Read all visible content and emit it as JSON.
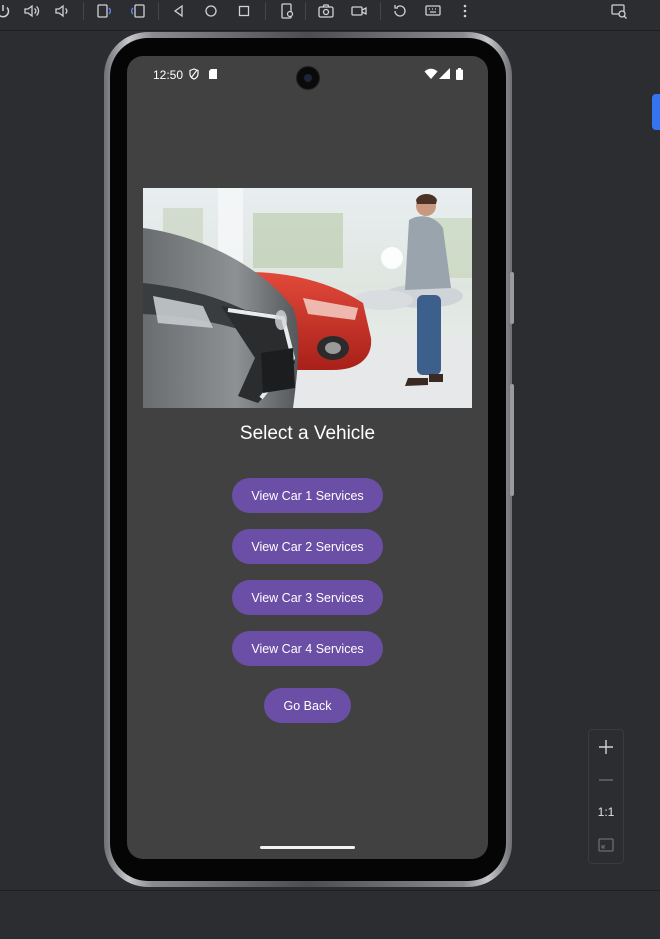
{
  "emulator": {
    "toolbar_icons": [
      "power-icon",
      "volume-up-icon",
      "volume-down-icon",
      "rotate-left-icon",
      "rotate-right-icon",
      "back-icon",
      "home-icon",
      "overview-icon",
      "device-settings-icon",
      "camera-icon",
      "record-icon",
      "reset-icon",
      "keyboard-icon",
      "more-icon",
      "snapshot-icon"
    ],
    "zoom": {
      "label": "1:1"
    }
  },
  "status_bar": {
    "time": "12:50"
  },
  "app": {
    "hero_image_alt": "car-showroom-image",
    "title": "Select a Vehicle",
    "buttons": [
      {
        "label": "View Car 1 Services"
      },
      {
        "label": "View Car 2 Services"
      },
      {
        "label": "View Car 3 Services"
      },
      {
        "label": "View Car 4 Services"
      }
    ],
    "back_button": "Go Back"
  },
  "colors": {
    "accent": "#6b4ea6",
    "screen_bg": "#414141",
    "ide_bg": "#2b2d30"
  }
}
